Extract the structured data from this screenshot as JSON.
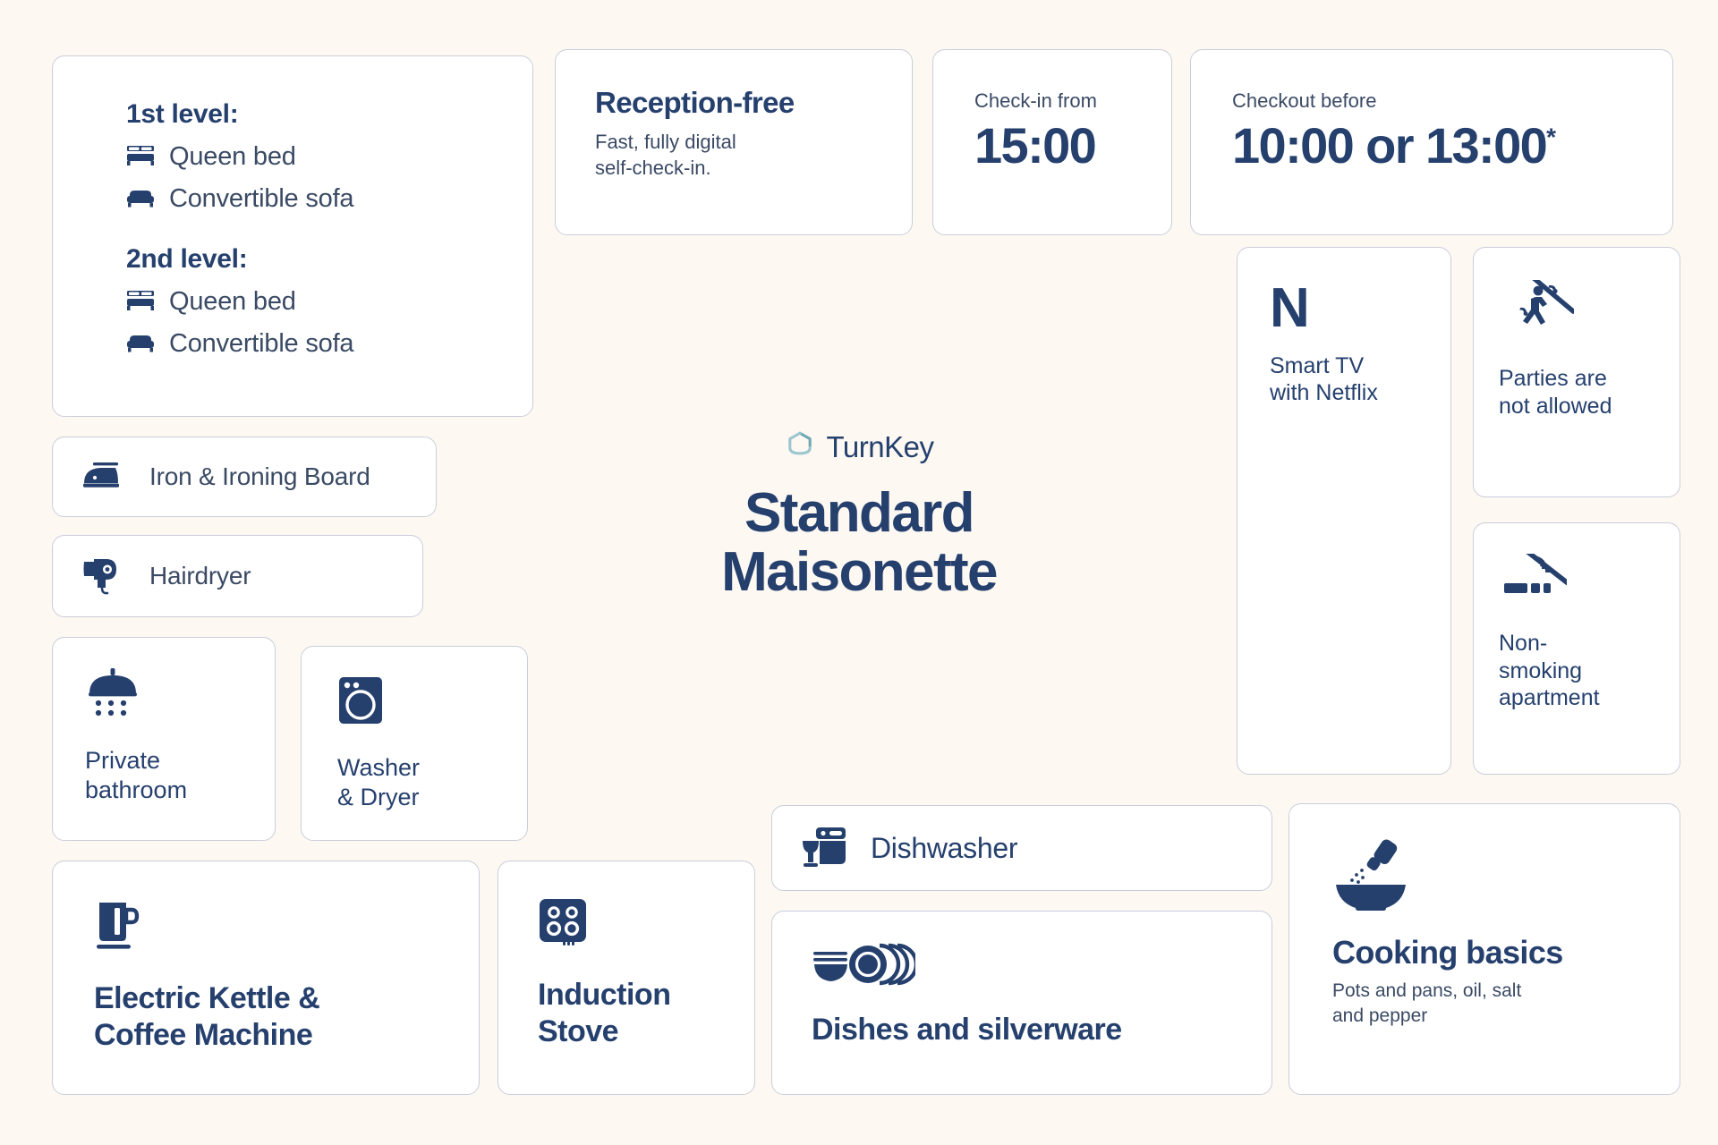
{
  "brand": {
    "logo_icon": "turnkey-house-icon",
    "name": "TurnKey",
    "title_line1": "Standard",
    "title_line2": "Maisonette"
  },
  "colors": {
    "background": "#FDF8F2",
    "card": "#FFFFFF",
    "border": "#C9CEDB",
    "navy": "#26406E",
    "body_text": "#3A4A64",
    "teal": "#7FB3BC"
  },
  "sleeping": {
    "levels": [
      {
        "title": "1st level:",
        "items": [
          {
            "icon": "bed-icon",
            "label": "Queen bed"
          },
          {
            "icon": "sofa-icon",
            "label": "Convertible sofa"
          }
        ]
      },
      {
        "title": "2nd level:",
        "items": [
          {
            "icon": "bed-icon",
            "label": "Queen bed"
          },
          {
            "icon": "sofa-icon",
            "label": "Convertible sofa"
          }
        ]
      }
    ]
  },
  "reception": {
    "title": "Reception-free",
    "subtitle_line1": "Fast, fully digital",
    "subtitle_line2": "self-check-in."
  },
  "checkin": {
    "label": "Check-in from",
    "time": "15:00"
  },
  "checkout": {
    "label": "Checkout before",
    "time": "10:00 or 13:00",
    "footnote_marker": "*"
  },
  "smart_tv": {
    "icon": "netflix-n-icon",
    "logo_letter": "N",
    "label_line1": "Smart TV",
    "label_line2": "with Netflix"
  },
  "parties": {
    "icon": "no-parties-icon",
    "label_line1": "Parties are",
    "label_line2": "not allowed"
  },
  "smoking": {
    "icon": "no-smoking-icon",
    "label_line1": "Non-",
    "label_line2": "smoking",
    "label_line3": "apartment"
  },
  "iron": {
    "icon": "iron-icon",
    "label": "Iron & Ironing Board"
  },
  "hairdryer": {
    "icon": "hairdryer-icon",
    "label": "Hairdryer"
  },
  "bathroom": {
    "icon": "shower-icon",
    "label_line1": "Private",
    "label_line2": "bathroom"
  },
  "washer": {
    "icon": "washing-machine-icon",
    "label_line1": "Washer",
    "label_line2": "& Dryer"
  },
  "kettle": {
    "icon": "kettle-icon",
    "label_line1": "Electric Kettle &",
    "label_line2": "Coffee Machine"
  },
  "stove": {
    "icon": "induction-stove-icon",
    "label_line1": "Induction",
    "label_line2": "Stove"
  },
  "dishwasher": {
    "icon": "dishwasher-icon",
    "label": "Dishwasher"
  },
  "dishes": {
    "icon": "dishes-icon",
    "label": "Dishes and silverware"
  },
  "cooking": {
    "icon": "cooking-basics-icon",
    "title": "Cooking basics",
    "subtitle_line1": "Pots and pans, oil, salt",
    "subtitle_line2": "and pepper"
  }
}
